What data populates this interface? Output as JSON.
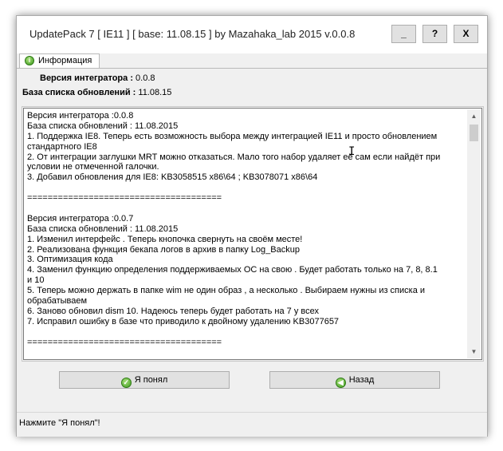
{
  "window": {
    "title": "UpdatePack 7 [ IE11 ] [ base: 11.08.15 ] by Mazahaka_lab 2015 v.0.0.8",
    "minimize_label": "_",
    "help_label": "?",
    "close_label": "X"
  },
  "tab": {
    "label": "Информация",
    "icon": "info-icon"
  },
  "info": {
    "integrator_label": "Версия интегратора :",
    "integrator_value": "0.0.8",
    "base_label": "База списка обновлений :",
    "base_value": "11.08.15"
  },
  "changelog": {
    "lines": [
      "Версия интегратора :0.0.8",
      "База списка обновлений : 11.08.2015",
      "1. Поддержка IE8. Теперь есть возможность выбора между интеграцией IE11 и просто обновлением",
      "стандартного IE8",
      "2. От интеграции заглушки MRT можно отказаться. Мало того  набор  удаляет её сам  если найдёт при",
      "условии не отмеченной  галочки.",
      "3. Добавил обновления для IE8: KB3058515 x86\\64 ; KB3078071 x86\\64",
      "",
      "    ======================================",
      "",
      "Версия интегратора :0.0.7",
      "База списка обновлений : 11.08.2015",
      "1. Изменил интерфейс . Теперь кнопочка  свернуть на своём  месте!",
      "2. Реализована функция бекапа логов в архив в папку Log_Backup",
      "3. Оптимизация кода",
      "4. Заменил функцию  определения  поддерживаемых ОС на свою . Будет работать только на 7, 8, 8.1",
      "и 10",
      "5. Теперь можно  держать в папке wim  не один образ , а несколько . Выбираем  нужны из списка и",
      "обрабатываем",
      "6. Заново обновил dism 10. Надеюсь теперь  будет работать на 7 у всех",
      "7. Исправил ошибку в базе  что приводило к  двойному удалению KB3077657",
      "",
      "     ======================================"
    ]
  },
  "buttons": {
    "ok_label": "Я понял",
    "back_label": "Назад"
  },
  "status": {
    "text": "Нажмите \"Я понял\"!"
  },
  "colors": {
    "accent_green": "#3d9b1e",
    "window_bg": "#f0f0f0",
    "button_bg": "#e1e1e1"
  }
}
